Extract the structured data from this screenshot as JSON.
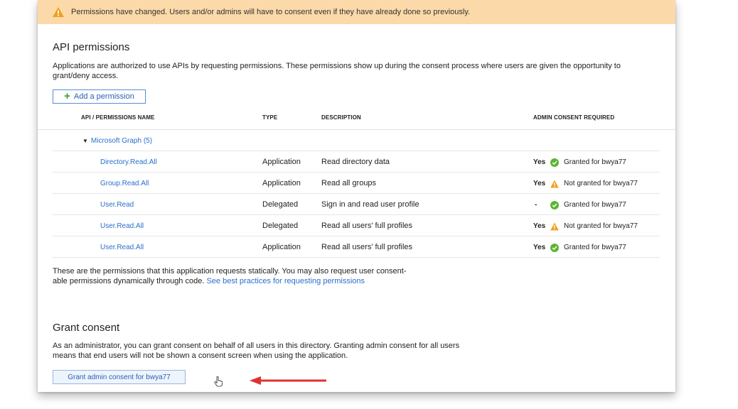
{
  "banner": {
    "text": "Permissions have changed. Users and/or admins will have to consent even if they have already done so previously.",
    "icon": "warning-triangle-icon",
    "bg_color": "#fcd9a8"
  },
  "api_permissions": {
    "title": "API permissions",
    "description": "Applications are authorized to use APIs by requesting permissions. These permissions show up during the consent process where users are given the opportunity to grant/deny access.",
    "add_button_label": "Add a permission",
    "columns": [
      "API / PERMISSIONS NAME",
      "TYPE",
      "DESCRIPTION",
      "ADMIN CONSENT REQUIRED"
    ],
    "group": "Microsoft Graph (5)",
    "rows": [
      {
        "name": "Directory.Read.All",
        "type": "Application",
        "description": "Read directory data",
        "consent": "Yes",
        "status": "Granted for bwya77",
        "status_kind": "granted"
      },
      {
        "name": "Group.Read.All",
        "type": "Application",
        "description": "Read all groups",
        "consent": "Yes",
        "status": "Not granted for bwya77",
        "status_kind": "warning"
      },
      {
        "name": "User.Read",
        "type": "Delegated",
        "description": "Sign in and read user profile",
        "consent": "-",
        "status": "Granted for bwya77",
        "status_kind": "granted"
      },
      {
        "name": "User.Read.All",
        "type": "Delegated",
        "description": "Read all users' full profiles",
        "consent": "Yes",
        "status": "Not granted for bwya77",
        "status_kind": "warning"
      },
      {
        "name": "User.Read.All",
        "type": "Application",
        "description": "Read all users' full profiles",
        "consent": "Yes",
        "status": "Granted for bwya77",
        "status_kind": "granted"
      }
    ],
    "footer_line1": "These are the permissions that this application requests statically. You may also request user consent-",
    "footer_line2": "able permissions dynamically through code.",
    "footer_link": "See best practices for requesting permissions"
  },
  "grant_consent": {
    "title": "Grant consent",
    "line1": "As an administrator, you can grant consent on behalf of all users in this directory. Granting admin consent for all users",
    "line2": "means that end users will not be shown a consent screen when using the application.",
    "button_label": "Grant admin consent for bwya77"
  },
  "colors": {
    "link": "#2a6fcc",
    "granted": "#5cb531",
    "warning": "#f0a020",
    "arrow": "#e03030"
  }
}
